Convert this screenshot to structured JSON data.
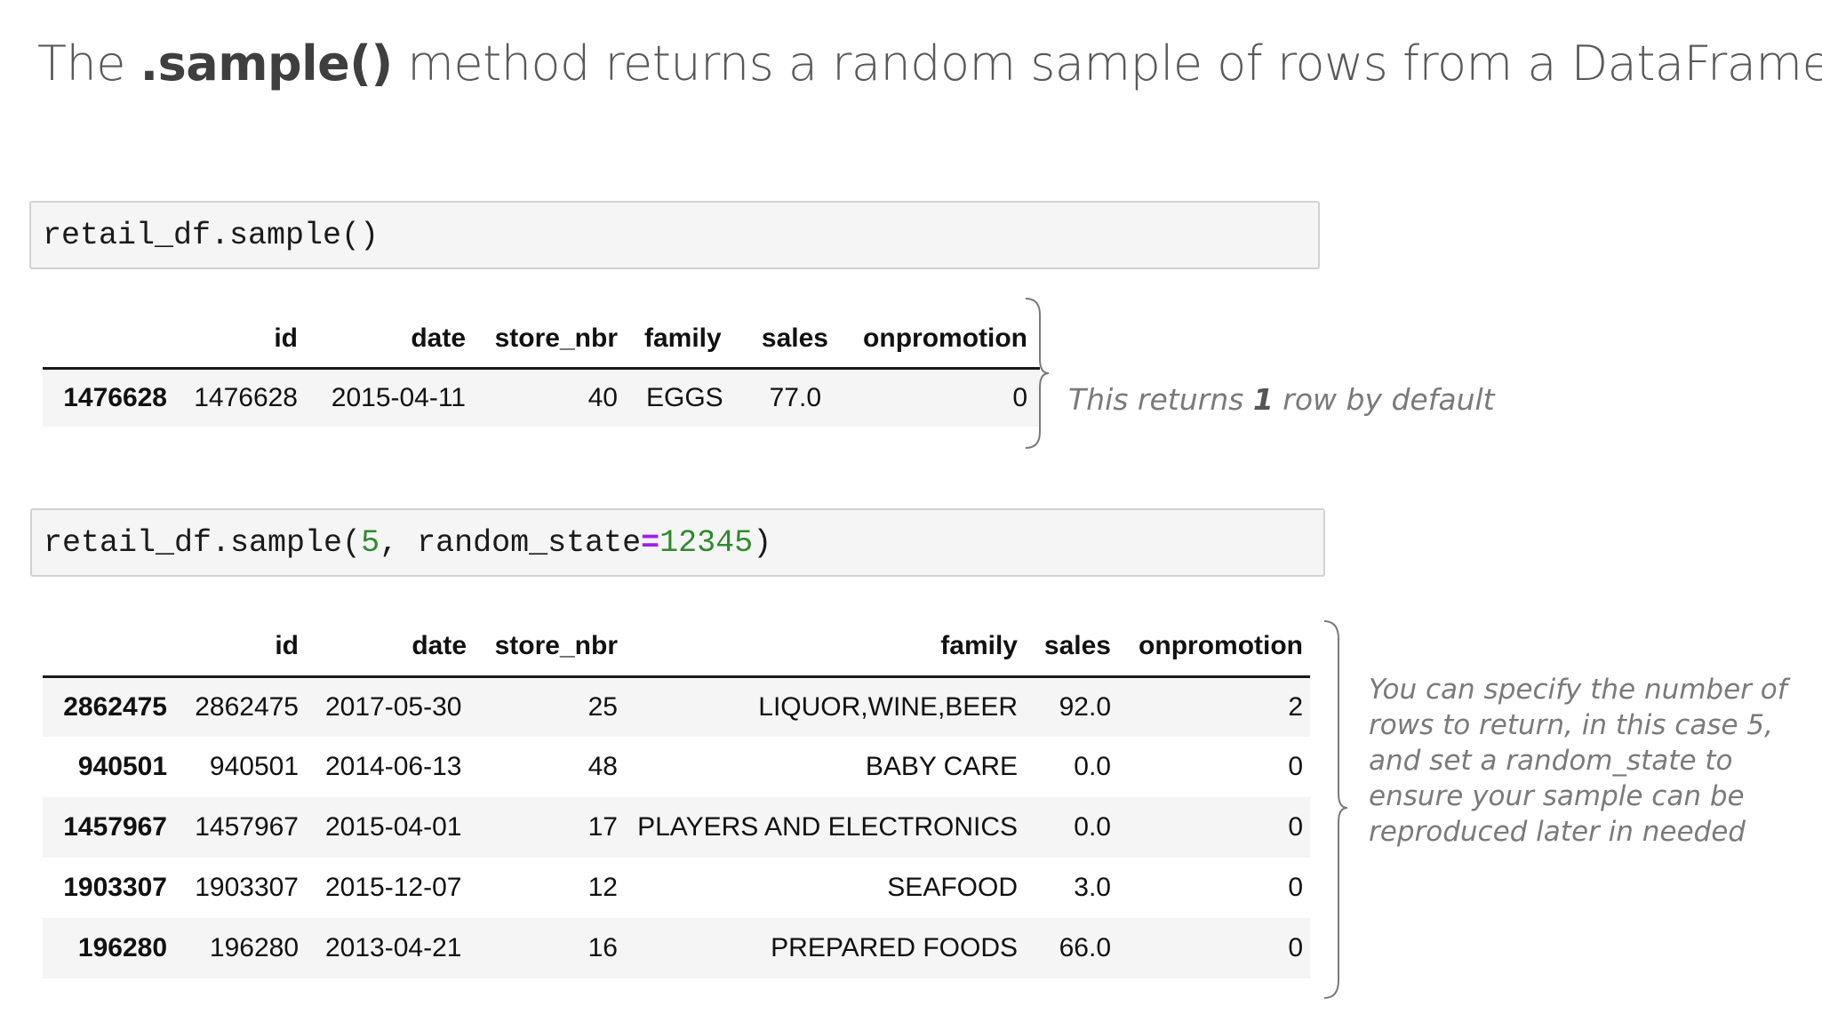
{
  "title": {
    "prefix": "The ",
    "method": ".sample()",
    "suffix": " method returns a random sample of rows from a DataFrame"
  },
  "cell1": {
    "code": "retail_df.sample()"
  },
  "table1": {
    "columns": [
      "id",
      "date",
      "store_nbr",
      "family",
      "sales",
      "onpromotion"
    ],
    "rows": [
      {
        "index": "1476628",
        "id": "1476628",
        "date": "2015-04-11",
        "store_nbr": "40",
        "family": "EGGS",
        "sales": "77.0",
        "onpromotion": "0"
      }
    ]
  },
  "note1": {
    "prefix": "This returns ",
    "bold": "1",
    "suffix": " row by default"
  },
  "cell2": {
    "code_prefix": "retail_df.sample(",
    "arg_num": "5",
    "sep": ", random_state",
    "eq": "=",
    "seed": "12345",
    "close": ")"
  },
  "table2": {
    "columns": [
      "id",
      "date",
      "store_nbr",
      "family",
      "sales",
      "onpromotion"
    ],
    "rows": [
      {
        "index": "2862475",
        "id": "2862475",
        "date": "2017-05-30",
        "store_nbr": "25",
        "family": "LIQUOR,WINE,BEER",
        "sales": "92.0",
        "onpromotion": "2"
      },
      {
        "index": "940501",
        "id": "940501",
        "date": "2014-06-13",
        "store_nbr": "48",
        "family": "BABY CARE",
        "sales": "0.0",
        "onpromotion": "0"
      },
      {
        "index": "1457967",
        "id": "1457967",
        "date": "2015-04-01",
        "store_nbr": "17",
        "family": "PLAYERS AND ELECTRONICS",
        "sales": "0.0",
        "onpromotion": "0"
      },
      {
        "index": "1903307",
        "id": "1903307",
        "date": "2015-12-07",
        "store_nbr": "12",
        "family": "SEAFOOD",
        "sales": "3.0",
        "onpromotion": "0"
      },
      {
        "index": "196280",
        "id": "196280",
        "date": "2013-04-21",
        "store_nbr": "16",
        "family": "PREPARED FOODS",
        "sales": "66.0",
        "onpromotion": "0"
      }
    ]
  },
  "note2": {
    "text": "You can specify the number of rows to return, in this case 5, and set a random_state to ensure your sample can be reproduced later in needed"
  }
}
